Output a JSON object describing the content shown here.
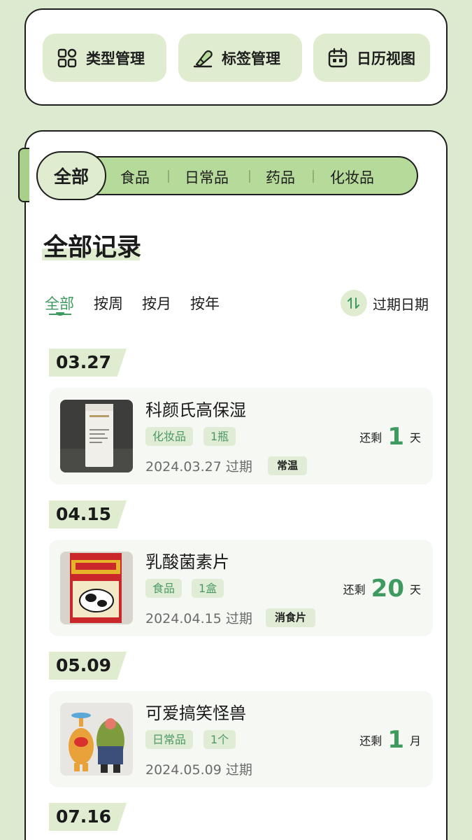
{
  "quick_actions": [
    {
      "label": "类型管理",
      "icon": "category-grid-icon"
    },
    {
      "label": "标签管理",
      "icon": "tag-edit-icon"
    },
    {
      "label": "日历视图",
      "icon": "calendar-icon"
    }
  ],
  "categories": {
    "active": "全部",
    "items": [
      "食品",
      "日常品",
      "药品",
      "化妆品"
    ]
  },
  "section_title": "全部记录",
  "period_tabs": [
    "全部",
    "按周",
    "按月",
    "按年"
  ],
  "sort_label": "过期日期",
  "colors": {
    "accent_green": "#3e9a5f",
    "light_green": "#dfeccf",
    "bar_green": "#b5da99",
    "background": "#dcebcf"
  },
  "records": [
    {
      "date_tag": "03.27",
      "name": "科颜氏高保湿",
      "category": "化妆品",
      "quantity": "1瓶",
      "expire_text": "2024.03.27 过期",
      "storage": "常温",
      "remain_prefix": "还剩",
      "remain_num": "1",
      "remain_unit": "天"
    },
    {
      "date_tag": "04.15",
      "name": "乳酸菌素片",
      "category": "食品",
      "quantity": "1盒",
      "expire_text": "2024.04.15 过期",
      "storage": "消食片",
      "remain_prefix": "还剩",
      "remain_num": "20",
      "remain_unit": "天"
    },
    {
      "date_tag": "05.09",
      "name": "可爱搞笑怪兽",
      "category": "日常品",
      "quantity": "1个",
      "expire_text": "2024.05.09 过期",
      "storage": "",
      "remain_prefix": "还剩",
      "remain_num": "1",
      "remain_unit": "月"
    },
    {
      "date_tag": "07.16"
    }
  ]
}
